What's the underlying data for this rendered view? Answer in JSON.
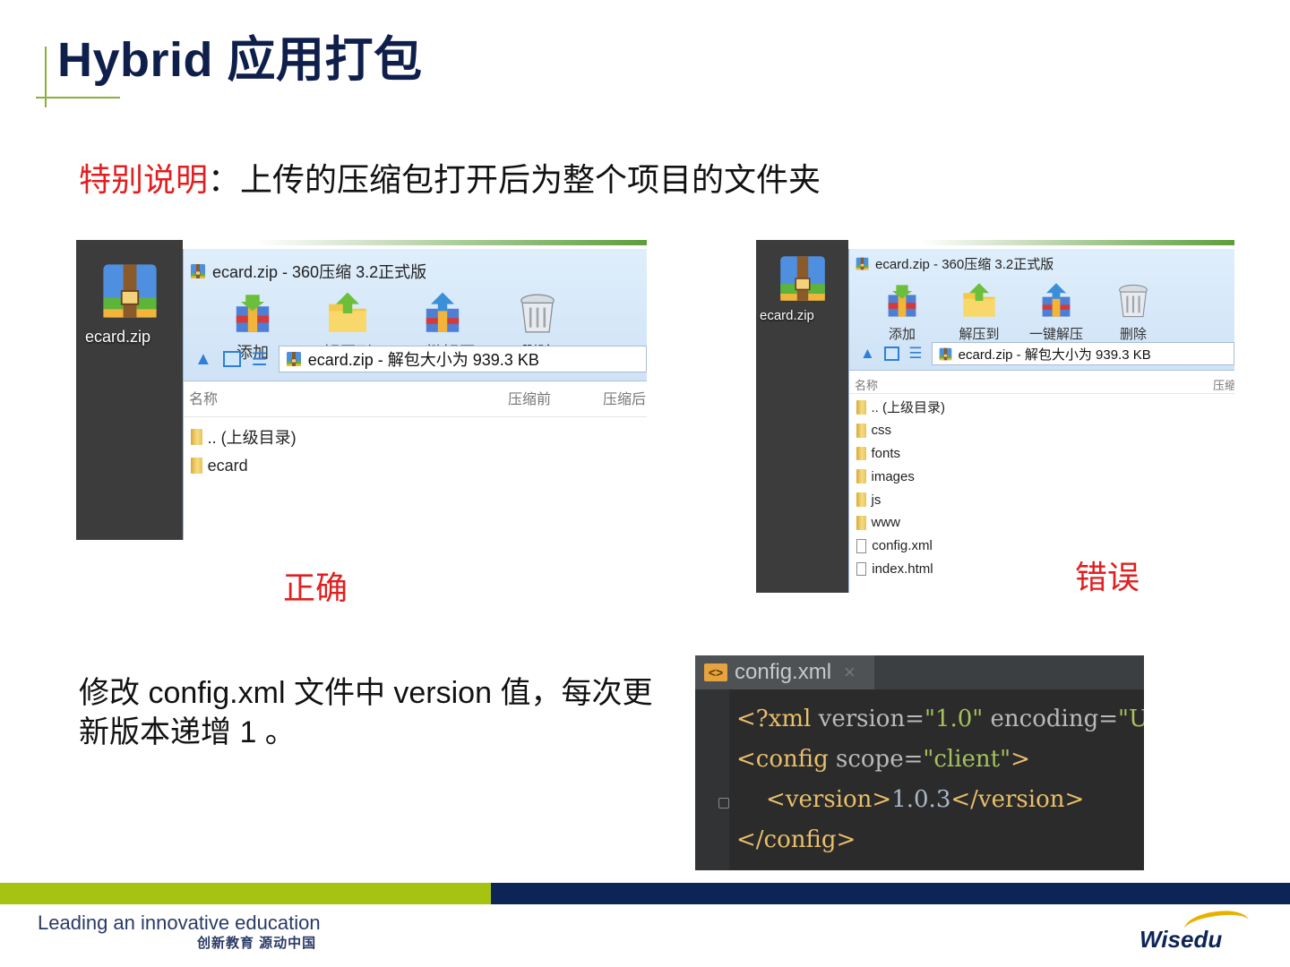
{
  "title": "Hybrid 应用打包",
  "note": {
    "label": "特别说明",
    "colon": "：",
    "text": "上传的压缩包打开后为整个项目的文件夹"
  },
  "correct_panel": {
    "desktop_label": "ecard.zip",
    "window_title": "ecard.zip - 360压缩 3.2正式版",
    "tools": [
      "添加",
      "解压到",
      "一键解压",
      "删除"
    ],
    "address": "ecard.zip - 解包大小为 939.3 KB",
    "columns": [
      "名称",
      "压缩前",
      "压缩后"
    ],
    "rows": [
      ".. (上级目录)",
      "ecard"
    ],
    "caption": "正确"
  },
  "wrong_panel": {
    "desktop_label": "ecard.zip",
    "window_title": "ecard.zip - 360压缩 3.2正式版",
    "tools": [
      "添加",
      "解压到",
      "一键解压",
      "删除"
    ],
    "address": "ecard.zip - 解包大小为 939.3 KB",
    "columns": [
      "名称",
      "压缩"
    ],
    "folders": [
      ".. (上级目录)",
      "css",
      "fonts",
      "images",
      "js",
      "www"
    ],
    "files": [
      "config.xml",
      "index.html"
    ],
    "caption": "错误"
  },
  "paragraph": "修改 config.xml 文件中 version 值，每次更新版本递增 1 。",
  "code": {
    "tab": "config.xml",
    "tab_close": "×",
    "lines": [
      [
        {
          "t": "tag",
          "v": "<?xml "
        },
        {
          "t": "attr",
          "v": "version="
        },
        {
          "t": "val",
          "v": "\"1.0\""
        },
        {
          "t": "attr",
          "v": " encoding="
        },
        {
          "t": "val",
          "v": "\"UT"
        }
      ],
      [
        {
          "t": "tag",
          "v": "<config "
        },
        {
          "t": "attr",
          "v": "scope="
        },
        {
          "t": "val",
          "v": "\"client\""
        },
        {
          "t": "tag",
          "v": ">"
        }
      ],
      [
        {
          "t": "tag",
          "v": "    <version>"
        },
        {
          "t": "text",
          "v": "1.0.3"
        },
        {
          "t": "tag",
          "v": "</version>"
        }
      ],
      [
        {
          "t": "tag",
          "v": "</config>"
        }
      ]
    ]
  },
  "footer": {
    "slogan_en": "Leading an innovative education",
    "slogan_cn": "创新教育 源动中国",
    "logo": "Wisedu"
  },
  "colors": {
    "title": "#0f1f4b",
    "accent_red": "#e02020",
    "bar_green": "#a6c312",
    "bar_navy": "#0d2457"
  }
}
